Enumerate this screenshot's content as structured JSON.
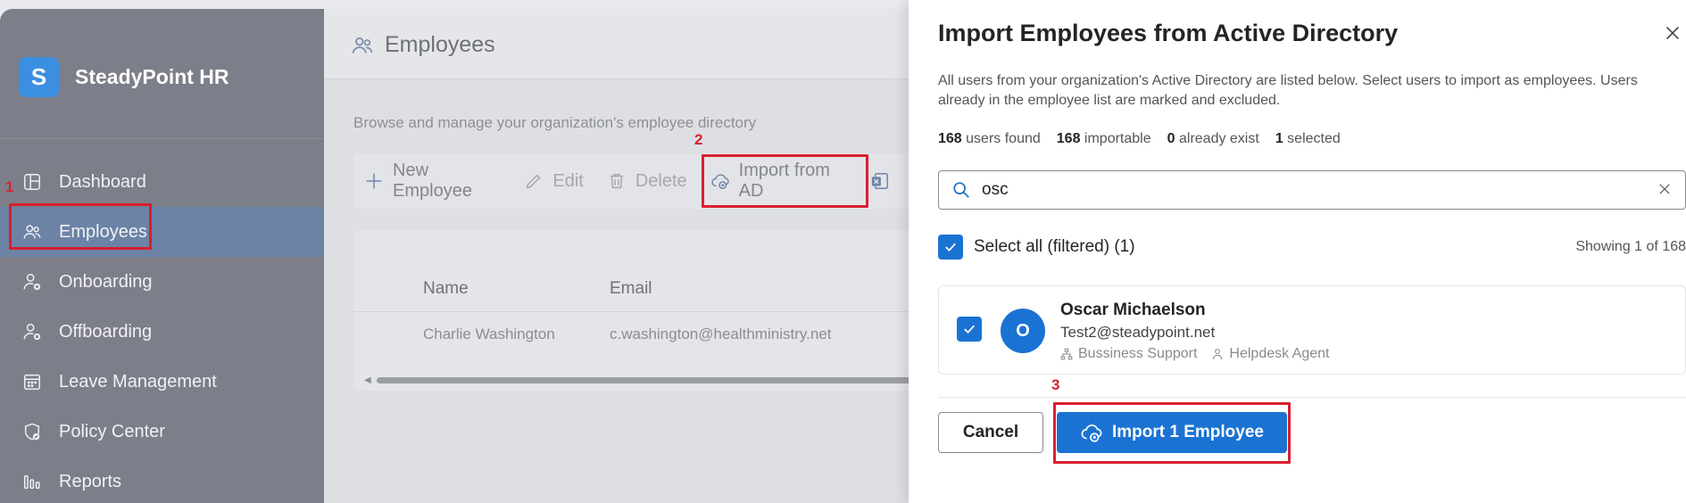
{
  "sidebar": {
    "brand_initial": "S",
    "brand_name": "SteadyPoint HR",
    "items": [
      {
        "label": "Dashboard",
        "icon": "dashboard-icon"
      },
      {
        "label": "Employees",
        "icon": "people-icon",
        "active": true
      },
      {
        "label": "Onboarding",
        "icon": "person-add-icon"
      },
      {
        "label": "Offboarding",
        "icon": "person-remove-icon"
      },
      {
        "label": "Leave Management",
        "icon": "calendar-icon"
      },
      {
        "label": "Policy Center",
        "icon": "shield-check-icon"
      },
      {
        "label": "Reports",
        "icon": "bar-chart-icon"
      }
    ]
  },
  "main": {
    "title": "Employees",
    "subtitle": "Browse and manage your organization's employee directory",
    "toolbar": {
      "new": "New Employee",
      "edit": "Edit",
      "delete": "Delete",
      "import": "Import from AD"
    },
    "table": {
      "columns": [
        "Name",
        "Email"
      ],
      "rows": [
        {
          "name": "Charlie Washington",
          "email": "c.washington@healthministry.net"
        }
      ]
    }
  },
  "annotations": [
    "1",
    "2",
    "3"
  ],
  "dialog": {
    "title": "Import Employees from Active Directory",
    "description": "All users from your organization's Active Directory are listed below. Select users to import as employees. Users already in the employee list are marked and excluded.",
    "stats": {
      "found_count": "168",
      "found_label": "users found",
      "importable_count": "168",
      "importable_label": "importable",
      "exist_count": "0",
      "exist_label": "already exist",
      "selected_count": "1",
      "selected_label": "selected"
    },
    "search_value": "osc",
    "select_all_label": "Select all (filtered) (1)",
    "showing": "Showing 1 of 168",
    "user": {
      "initial": "O",
      "name": "Oscar Michaelson",
      "email": "Test2@steadypoint.net",
      "department": "Bussiness Support",
      "role": "Helpdesk Agent"
    },
    "cancel_label": "Cancel",
    "import_label": "Import 1 Employee"
  },
  "colors": {
    "accent": "#1a73d3",
    "annotation": "#d81f30",
    "sidebar_overlay": "#7c7e89"
  }
}
